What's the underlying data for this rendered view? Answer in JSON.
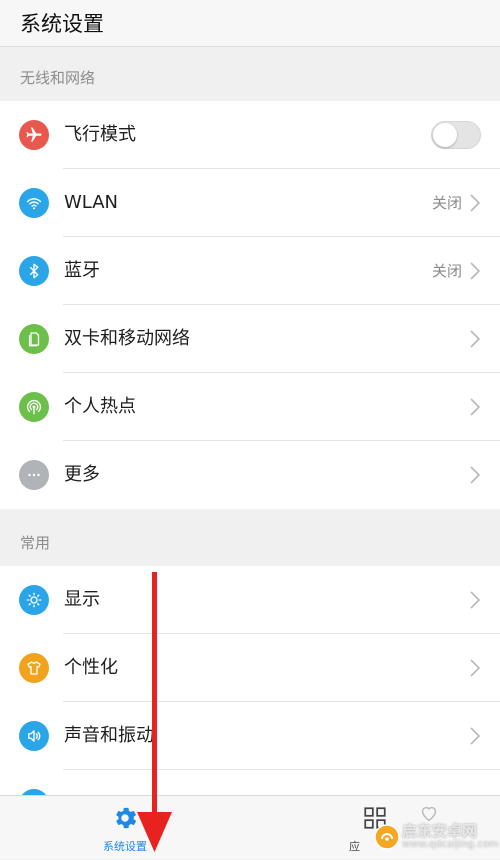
{
  "header": {
    "title": "系统设置"
  },
  "sections": {
    "wireless": {
      "title": "无线和网络",
      "items": [
        {
          "label": "飞行模式",
          "icon": "airplane-icon",
          "color": "#e9584f",
          "toggle": "off"
        },
        {
          "label": "WLAN",
          "icon": "wifi-icon",
          "color": "#29a5e8",
          "status": "关闭"
        },
        {
          "label": "蓝牙",
          "icon": "bluetooth-icon",
          "color": "#29a5e8",
          "status": "关闭"
        },
        {
          "label": "双卡和移动网络",
          "icon": "sim-card-icon",
          "color": "#6cc04a"
        },
        {
          "label": "个人热点",
          "icon": "hotspot-icon",
          "color": "#6cc04a"
        },
        {
          "label": "更多",
          "icon": "more-icon",
          "color": "#b0b4b8"
        }
      ]
    },
    "common": {
      "title": "常用",
      "items": [
        {
          "label": "显示",
          "icon": "brightness-icon",
          "color": "#29a5e8"
        },
        {
          "label": "个性化",
          "icon": "shirt-icon",
          "color": "#f2a31b"
        },
        {
          "label": "声音和振动",
          "icon": "speaker-icon",
          "color": "#29a5e8"
        }
      ]
    }
  },
  "tabbar": {
    "tabs": [
      {
        "label": "系统设置",
        "icon": "gear-icon",
        "active": true,
        "color": "#1e88e5"
      },
      {
        "label": "应",
        "icon": "apps-grid-icon",
        "active": false
      },
      {
        "label": "",
        "icon": "heart-icon",
        "active": false
      }
    ]
  },
  "watermark": {
    "text": "启东安卓网",
    "url": "www.qdcaijing.com"
  },
  "colors": {
    "accent": "#1e88e5",
    "annotation_arrow": "#e8231f"
  }
}
